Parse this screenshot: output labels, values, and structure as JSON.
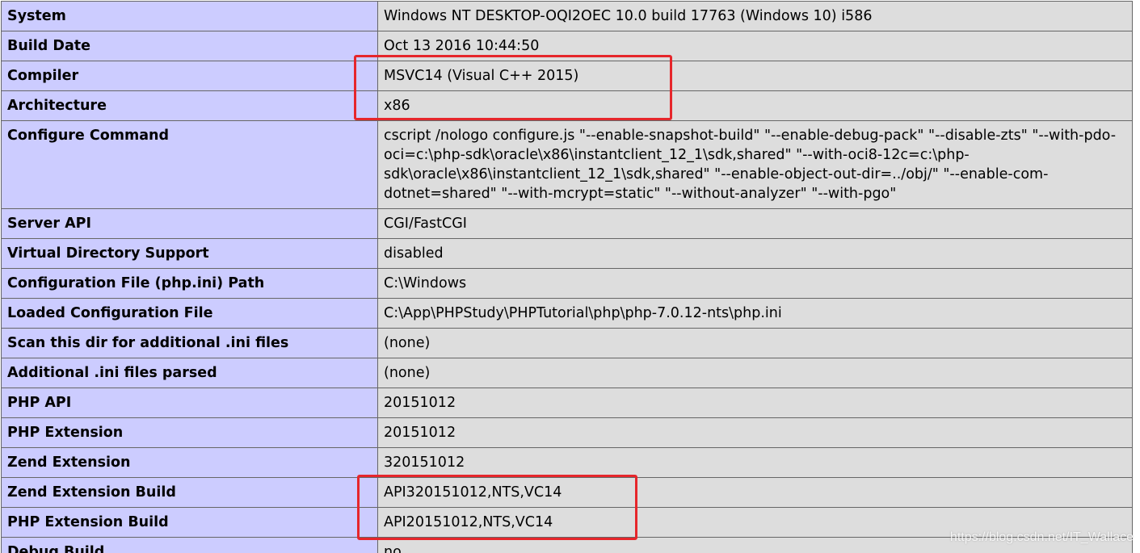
{
  "rows": [
    {
      "key": "System",
      "value": "Windows NT DESKTOP-OQI2OEC 10.0 build 17763 (Windows 10) i586"
    },
    {
      "key": "Build Date",
      "value": "Oct 13 2016 10:44:50"
    },
    {
      "key": "Compiler",
      "value": "MSVC14 (Visual C++ 2015)"
    },
    {
      "key": "Architecture",
      "value": "x86"
    },
    {
      "key": "Configure Command",
      "value": "cscript /nologo configure.js \"--enable-snapshot-build\" \"--enable-debug-pack\" \"--disable-zts\" \"--with-pdo-oci=c:\\php-sdk\\oracle\\x86\\instantclient_12_1\\sdk,shared\" \"--with-oci8-12c=c:\\php-sdk\\oracle\\x86\\instantclient_12_1\\sdk,shared\" \"--enable-object-out-dir=../obj/\" \"--enable-com-dotnet=shared\" \"--with-mcrypt=static\" \"--without-analyzer\" \"--with-pgo\""
    },
    {
      "key": "Server API",
      "value": "CGI/FastCGI"
    },
    {
      "key": "Virtual Directory Support",
      "value": "disabled"
    },
    {
      "key": "Configuration File (php.ini) Path",
      "value": "C:\\Windows"
    },
    {
      "key": "Loaded Configuration File",
      "value": "C:\\App\\PHPStudy\\PHPTutorial\\php\\php-7.0.12-nts\\php.ini"
    },
    {
      "key": "Scan this dir for additional .ini files",
      "value": "(none)"
    },
    {
      "key": "Additional .ini files parsed",
      "value": "(none)"
    },
    {
      "key": "PHP API",
      "value": "20151012"
    },
    {
      "key": "PHP Extension",
      "value": "20151012"
    },
    {
      "key": "Zend Extension",
      "value": "320151012"
    },
    {
      "key": "Zend Extension Build",
      "value": "API320151012,NTS,VC14"
    },
    {
      "key": "PHP Extension Build",
      "value": "API20151012,NTS,VC14"
    },
    {
      "key": "Debug Build",
      "value": "no"
    }
  ],
  "colors": {
    "key_background": "#ccccff",
    "value_background": "#dddddd",
    "border": "#666666",
    "highlight": "#e6262b"
  },
  "watermark": "https://blog.csdn.net/IT_Wallace"
}
